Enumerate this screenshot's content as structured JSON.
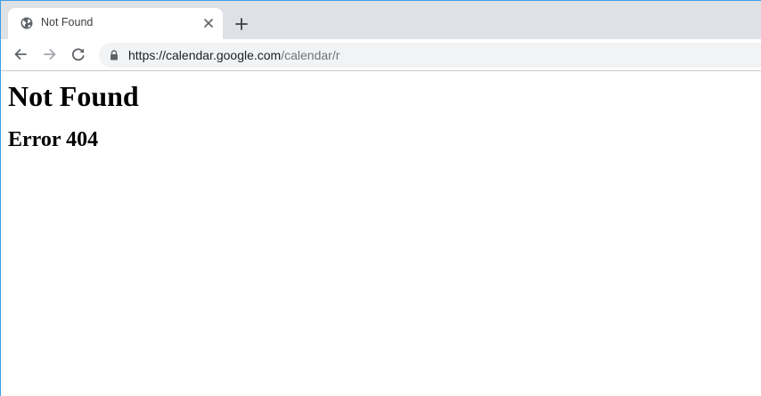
{
  "browser": {
    "tab": {
      "title": "Not Found",
      "favicon": "globe-icon",
      "close_icon": "close-icon"
    },
    "new_tab_icon": "plus-icon",
    "toolbar": {
      "back_icon": "back-arrow-icon",
      "forward_icon": "forward-arrow-icon",
      "reload_icon": "reload-icon",
      "lock_icon": "lock-icon",
      "url_host": "https://calendar.google.com",
      "url_path": "/calendar/r"
    },
    "colors": {
      "tabstrip": "#dee1e6",
      "omnibox": "#f1f3f4",
      "window_border": "#3c9ee6"
    }
  },
  "page": {
    "heading": "Not Found",
    "subheading": "Error 404"
  }
}
